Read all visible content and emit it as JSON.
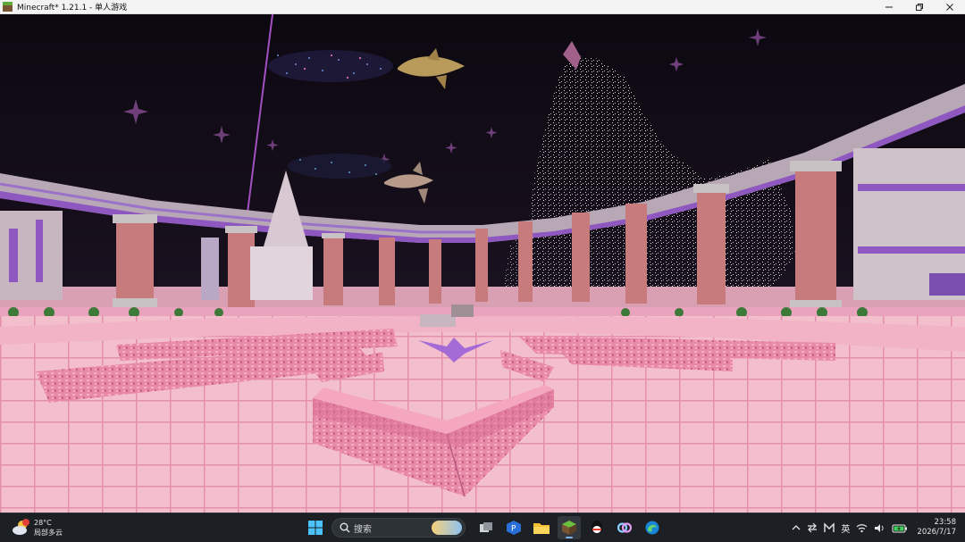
{
  "window": {
    "title": "Minecraft* 1.21.1 - 单人游戏",
    "controls": [
      "minimize",
      "restore",
      "close"
    ]
  },
  "game": {
    "scene": "pink cherry-block courtyard with colonnade and particle statues at night",
    "colors": {
      "sky": "#0e0a12",
      "floor": "#f2b8c6",
      "floor_lines": "#e08aa6",
      "pillar": "#c97a7c",
      "purple": "#a46bd6",
      "particles": "#cfcfc8"
    }
  },
  "taskbar": {
    "weather": {
      "temp": "28°C",
      "desc": "局部多云",
      "icon": "weather-cloud-sun-icon",
      "badge": "1"
    },
    "search_label": "搜索",
    "apps": [
      {
        "name": "windows-start-icon"
      },
      {
        "name": "task-view-icon"
      },
      {
        "name": "p-app-icon"
      },
      {
        "name": "file-explorer-icon"
      },
      {
        "name": "minecraft-icon",
        "active": true
      },
      {
        "name": "qq-icon"
      },
      {
        "name": "copilot-icon"
      },
      {
        "name": "edge-icon"
      }
    ],
    "tray": {
      "ime": "英",
      "time": "23:58",
      "date": "2026/7/17"
    }
  }
}
